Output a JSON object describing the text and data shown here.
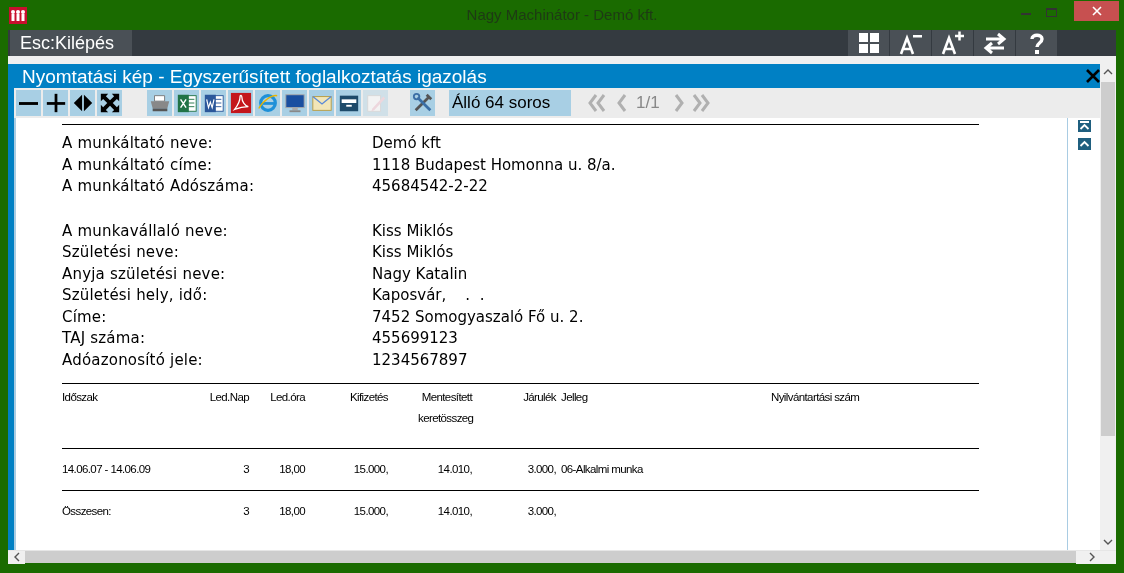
{
  "window": {
    "title": "Nagy Machinátor - Demó kft."
  },
  "menu_bar": {
    "exit_key": "Esc:",
    "exit_label": "Kilépés",
    "buttons": [
      {
        "kind": "tiles"
      },
      {
        "kind": "font-smaller"
      },
      {
        "kind": "font-larger"
      },
      {
        "kind": "swap"
      },
      {
        "kind": "help"
      }
    ]
  },
  "panel": {
    "title": "Nyomtatási kép - Egyszerűsített foglalkoztatás igazolás"
  },
  "toolbar": {
    "buttons": [
      {
        "kind": "zoom-out",
        "disabled": false
      },
      {
        "kind": "zoom-in",
        "disabled": false
      },
      {
        "kind": "fit-width",
        "disabled": false
      },
      {
        "kind": "fit-page",
        "disabled": false
      },
      {
        "kind": "printer",
        "disabled": false
      },
      {
        "kind": "excel",
        "disabled": false
      },
      {
        "kind": "word",
        "disabled": false
      },
      {
        "kind": "pdf",
        "disabled": false
      },
      {
        "kind": "browser",
        "disabled": false
      },
      {
        "kind": "monitor",
        "disabled": false
      },
      {
        "kind": "mail",
        "disabled": false
      },
      {
        "kind": "archive",
        "disabled": false
      },
      {
        "kind": "edit",
        "disabled": true
      },
      {
        "kind": "tools",
        "disabled": false
      }
    ],
    "orientation": "Álló 64 soros",
    "nav": [
      {
        "kind": "first",
        "disabled": true
      },
      {
        "kind": "prev",
        "disabled": true
      },
      {
        "kind": "page",
        "text": "1/1"
      },
      {
        "kind": "next",
        "disabled": true
      },
      {
        "kind": "last",
        "disabled": true
      }
    ]
  },
  "document": {
    "employer": [
      {
        "label": "A munkáltató neve:",
        "value": "Demó kft"
      },
      {
        "label": "A munkáltató címe:",
        "value": "1118 Budapest Homonna u. 8/a."
      },
      {
        "label": "A munkáltató Adószáma:",
        "value": "45684542-2-22"
      }
    ],
    "employee": [
      {
        "label": "A munkavállaló neve:",
        "value": "Kiss Miklós"
      },
      {
        "label": "Születési neve:",
        "value": "Kiss Miklós"
      },
      {
        "label": "Anyja születési neve:",
        "value": "Nagy Katalin"
      },
      {
        "label": "Születési hely, idő:",
        "value": "Kaposvár,    .  ."
      },
      {
        "label": "Címe:",
        "value": "7452 Somogyaszaló Fő u. 2."
      },
      {
        "label": "TAJ száma:",
        "value": "455699123"
      },
      {
        "label": "Adóazonosító jele:",
        "value": "1234567897"
      }
    ],
    "table": {
      "columns": [
        "Időszak",
        "Led.Nap",
        "Led.óra",
        "Kifizetés",
        "Mentesített keretösszeg",
        "Járulék",
        "Jelleg",
        "Nyilvántartási szám"
      ],
      "rows": [
        [
          "14.06.07 - 14.06.09",
          "3",
          "18,00",
          "15.000,",
          "14.010,",
          "3.000,",
          "06-Alkalmi munka"
        ]
      ],
      "total": [
        "Összesen:",
        "3",
        "18,00",
        "15.000,",
        "14.010,",
        "3.000,"
      ]
    }
  }
}
